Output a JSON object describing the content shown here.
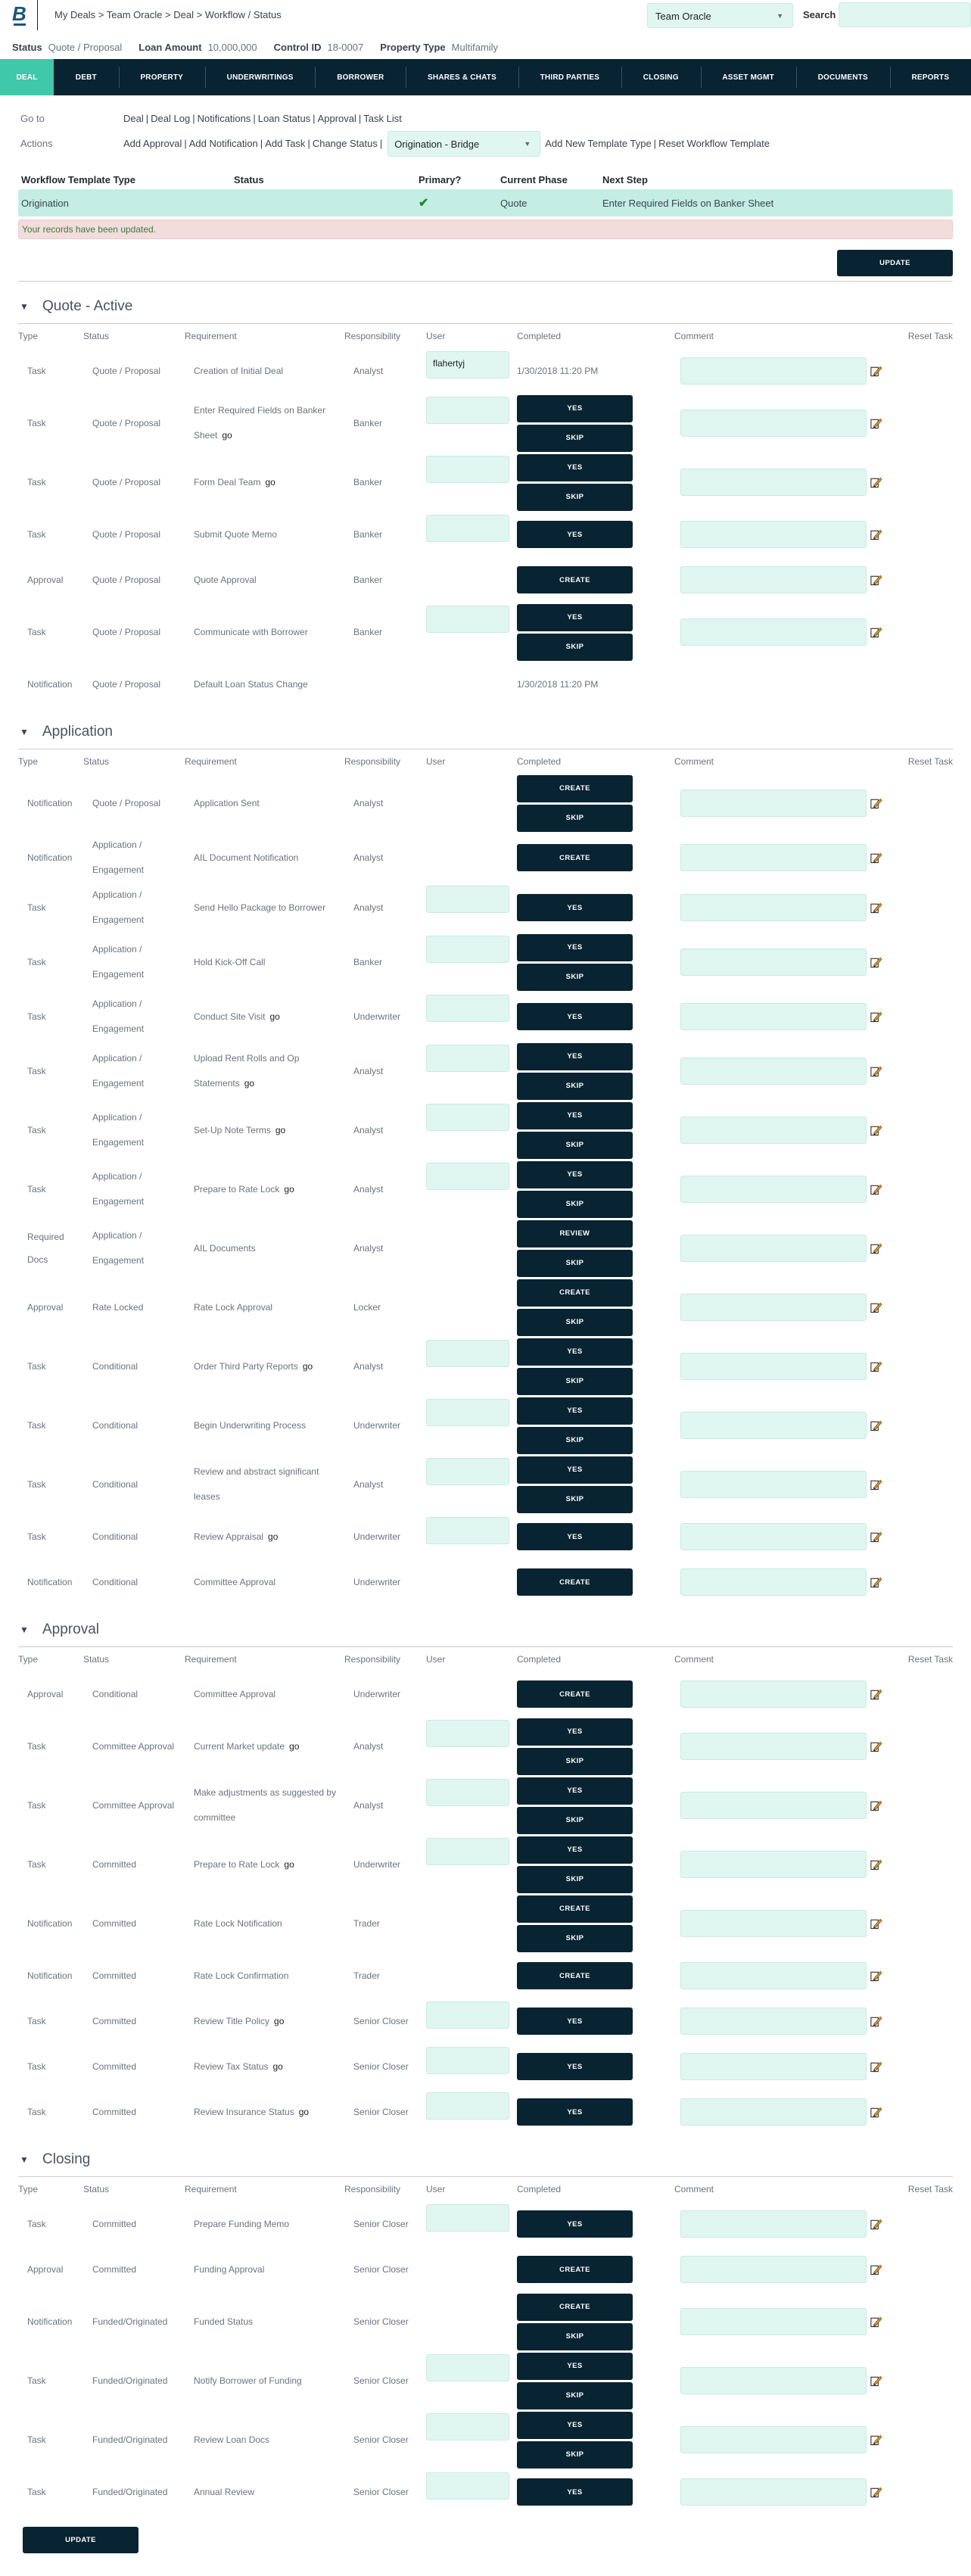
{
  "header": {
    "logo_letter": "B",
    "breadcrumb": "My Deals > Team Oracle > Deal > Workflow / Status",
    "team_select": "Team Oracle",
    "search_label": "Search",
    "search_value": ""
  },
  "info": {
    "status_label": "Status",
    "status_value": "Quote / Proposal",
    "loan_label": "Loan Amount",
    "loan_value": "10,000,000",
    "control_label": "Control ID",
    "control_value": "18-0007",
    "property_label": "Property Type",
    "property_value": "Multifamily"
  },
  "nav": {
    "tabs": [
      "DEAL",
      "DEBT",
      "PROPERTY",
      "UNDERWRITINGS",
      "BORROWER",
      "SHARES & CHATS",
      "THIRD PARTIES",
      "CLOSING",
      "ASSET MGMT",
      "DOCUMENTS",
      "REPORTS"
    ],
    "active": "DEAL"
  },
  "links": {
    "goto_label": "Go to",
    "goto": [
      "Deal",
      "Deal Log",
      "Notifications",
      "Loan Status",
      "Approval",
      "Task List"
    ],
    "actions_label": "Actions",
    "actions": [
      "Add Approval",
      "Add Notification",
      "Add Task",
      "Change Status"
    ],
    "template_select": "Origination - Bridge",
    "template_actions": [
      "Add New Template Type",
      "Reset Workflow Template"
    ]
  },
  "workflow": {
    "headers": [
      "Workflow Template Type",
      "Status",
      "Primary?",
      "Current Phase",
      "Next Step"
    ],
    "row": {
      "type": "Origination",
      "status": "",
      "primary": true,
      "phase": "Quote",
      "next_step": "Enter Required Fields on Banker Sheet"
    },
    "alert": "Your records have been updated."
  },
  "update_label": "UPDATE",
  "columns": [
    "Type",
    "Status",
    "Requirement",
    "Responsibility",
    "User",
    "Completed",
    "Comment",
    "Reset Task"
  ],
  "go_label": "go",
  "sections": [
    {
      "title": "Quote - Active",
      "rows": [
        {
          "type": "Task",
          "status": "Quote / Proposal",
          "req": "Creation of Initial Deal",
          "go": false,
          "resp": "Analyst",
          "user": "flahertyj",
          "completed": "1/30/2018 11:20 PM",
          "buttons": [],
          "comment": true
        },
        {
          "type": "Task",
          "status": "Quote / Proposal",
          "req": "Enter Required Fields on Banker Sheet",
          "go": true,
          "resp": "Banker",
          "user": "",
          "buttons": [
            "YES",
            "SKIP"
          ],
          "comment": true
        },
        {
          "type": "Task",
          "status": "Quote / Proposal",
          "req": "Form Deal Team",
          "go": true,
          "resp": "Banker",
          "user": "",
          "buttons": [
            "YES",
            "SKIP"
          ],
          "comment": true
        },
        {
          "type": "Task",
          "status": "Quote / Proposal",
          "req": "Submit Quote Memo",
          "go": false,
          "resp": "Banker",
          "user": "",
          "buttons": [
            "YES"
          ],
          "comment": true
        },
        {
          "type": "Approval",
          "status": "Quote / Proposal",
          "req": "Quote Approval",
          "go": false,
          "resp": "Banker",
          "buttons": [
            "CREATE"
          ],
          "comment": true
        },
        {
          "type": "Task",
          "status": "Quote / Proposal",
          "req": "Communicate with Borrower",
          "go": false,
          "resp": "Banker",
          "user": "",
          "buttons": [
            "YES",
            "SKIP"
          ],
          "comment": true
        },
        {
          "type": "Notification",
          "status": "Quote / Proposal",
          "req": "Default Loan Status Change",
          "go": false,
          "resp": "",
          "completed": "1/30/2018 11:20 PM",
          "buttons": [],
          "comment": false
        }
      ]
    },
    {
      "title": "Application",
      "rows": [
        {
          "type": "Notification",
          "status": "Quote / Proposal",
          "req": "Application Sent",
          "go": false,
          "resp": "Analyst",
          "buttons": [
            "CREATE",
            "SKIP"
          ],
          "comment": true
        },
        {
          "type": "Notification",
          "status": "Application / Engagement",
          "req": "AIL Document Notification",
          "go": false,
          "resp": "Analyst",
          "buttons": [
            "CREATE"
          ],
          "comment": true
        },
        {
          "type": "Task",
          "status": "Application / Engagement",
          "req": "Send Hello Package to Borrower",
          "go": false,
          "resp": "Analyst",
          "user": "",
          "buttons": [
            "YES"
          ],
          "comment": true
        },
        {
          "type": "Task",
          "status": "Application / Engagement",
          "req": "Hold Kick-Off Call",
          "go": false,
          "resp": "Banker",
          "user": "",
          "buttons": [
            "YES",
            "SKIP"
          ],
          "comment": true
        },
        {
          "type": "Task",
          "status": "Application / Engagement",
          "req": "Conduct Site Visit",
          "go": true,
          "resp": "Underwriter",
          "user": "",
          "buttons": [
            "YES"
          ],
          "comment": true
        },
        {
          "type": "Task",
          "status": "Application / Engagement",
          "req": "Upload Rent Rolls and Op Statements",
          "go": true,
          "resp": "Analyst",
          "user": "",
          "buttons": [
            "YES",
            "SKIP"
          ],
          "comment": true
        },
        {
          "type": "Task",
          "status": "Application / Engagement",
          "req": "Set-Up Note Terms",
          "go": true,
          "resp": "Analyst",
          "user": "",
          "buttons": [
            "YES",
            "SKIP"
          ],
          "comment": true
        },
        {
          "type": "Task",
          "status": "Application / Engagement",
          "req": "Prepare to Rate Lock",
          "go": true,
          "resp": "Analyst",
          "user": "",
          "buttons": [
            "YES",
            "SKIP"
          ],
          "comment": true
        },
        {
          "type": "Required Docs",
          "status": "Application / Engagement",
          "req": "AIL Documents",
          "go": false,
          "resp": "Analyst",
          "buttons": [
            "REVIEW",
            "SKIP"
          ],
          "comment": true
        },
        {
          "type": "Approval",
          "status": "Rate Locked",
          "req": "Rate Lock Approval",
          "go": false,
          "resp": "Locker",
          "buttons": [
            "CREATE",
            "SKIP"
          ],
          "comment": true
        },
        {
          "type": "Task",
          "status": "Conditional",
          "req": "Order Third Party Reports",
          "go": true,
          "resp": "Analyst",
          "user": "",
          "buttons": [
            "YES",
            "SKIP"
          ],
          "comment": true
        },
        {
          "type": "Task",
          "status": "Conditional",
          "req": "Begin Underwriting Process",
          "go": false,
          "resp": "Underwriter",
          "user": "",
          "buttons": [
            "YES",
            "SKIP"
          ],
          "comment": true
        },
        {
          "type": "Task",
          "status": "Conditional",
          "req": "Review and abstract significant leases",
          "go": false,
          "resp": "Analyst",
          "user": "",
          "buttons": [
            "YES",
            "SKIP"
          ],
          "comment": true
        },
        {
          "type": "Task",
          "status": "Conditional",
          "req": "Review Appraisal",
          "go": true,
          "resp": "Underwriter",
          "user": "",
          "buttons": [
            "YES"
          ],
          "comment": true
        },
        {
          "type": "Notification",
          "status": "Conditional",
          "req": "Committee Approval",
          "go": false,
          "resp": "Underwriter",
          "buttons": [
            "CREATE"
          ],
          "comment": true
        }
      ]
    },
    {
      "title": "Approval",
      "rows": [
        {
          "type": "Approval",
          "status": "Conditional",
          "req": "Committee Approval",
          "go": false,
          "resp": "Underwriter",
          "buttons": [
            "CREATE"
          ],
          "comment": true
        },
        {
          "type": "Task",
          "status": "Committee Approval",
          "req": "Current Market update",
          "go": true,
          "resp": "Analyst",
          "user": "",
          "buttons": [
            "YES",
            "SKIP"
          ],
          "comment": true
        },
        {
          "type": "Task",
          "status": "Committee Approval",
          "req": "Make adjustments as suggested by committee",
          "go": false,
          "resp": "Analyst",
          "user": "",
          "buttons": [
            "YES",
            "SKIP"
          ],
          "comment": true
        },
        {
          "type": "Task",
          "status": "Committed",
          "req": "Prepare to Rate Lock",
          "go": true,
          "resp": "Underwriter",
          "user": "",
          "buttons": [
            "YES",
            "SKIP"
          ],
          "comment": true
        },
        {
          "type": "Notification",
          "status": "Committed",
          "req": "Rate Lock Notification",
          "go": false,
          "resp": "Trader",
          "buttons": [
            "CREATE",
            "SKIP"
          ],
          "comment": true
        },
        {
          "type": "Notification",
          "status": "Committed",
          "req": "Rate Lock Confirmation",
          "go": false,
          "resp": "Trader",
          "buttons": [
            "CREATE"
          ],
          "comment": true
        },
        {
          "type": "Task",
          "status": "Committed",
          "req": "Review Title Policy",
          "go": true,
          "resp": "Senior Closer",
          "user": "",
          "buttons": [
            "YES"
          ],
          "comment": true
        },
        {
          "type": "Task",
          "status": "Committed",
          "req": "Review Tax Status",
          "go": true,
          "resp": "Senior Closer",
          "user": "",
          "buttons": [
            "YES"
          ],
          "comment": true
        },
        {
          "type": "Task",
          "status": "Committed",
          "req": "Review Insurance Status",
          "go": true,
          "resp": "Senior Closer",
          "user": "",
          "buttons": [
            "YES"
          ],
          "comment": true
        }
      ]
    },
    {
      "title": "Closing",
      "rows": [
        {
          "type": "Task",
          "status": "Committed",
          "req": "Prepare Funding Memo",
          "go": false,
          "resp": "Senior Closer",
          "user": "",
          "buttons": [
            "YES"
          ],
          "comment": true
        },
        {
          "type": "Approval",
          "status": "Committed",
          "req": "Funding Approval",
          "go": false,
          "resp": "Senior Closer",
          "buttons": [
            "CREATE"
          ],
          "comment": true
        },
        {
          "type": "Notification",
          "status": "Funded/Originated",
          "req": "Funded Status",
          "go": false,
          "resp": "Senior Closer",
          "buttons": [
            "CREATE",
            "SKIP"
          ],
          "comment": true
        },
        {
          "type": "Task",
          "status": "Funded/Originated",
          "req": "Notify Borrower of Funding",
          "go": false,
          "resp": "Senior Closer",
          "user": "",
          "buttons": [
            "YES",
            "SKIP"
          ],
          "comment": true
        },
        {
          "type": "Task",
          "status": "Funded/Originated",
          "req": "Review Loan Docs",
          "go": false,
          "resp": "Senior Closer",
          "user": "",
          "buttons": [
            "YES",
            "SKIP"
          ],
          "comment": true
        },
        {
          "type": "Task",
          "status": "Funded/Originated",
          "req": "Annual Review",
          "go": false,
          "resp": "Senior Closer",
          "user": "",
          "buttons": [
            "YES"
          ],
          "comment": true
        }
      ]
    }
  ]
}
